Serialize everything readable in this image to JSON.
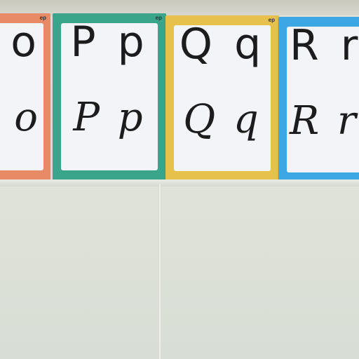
{
  "cards": [
    {
      "id": "o",
      "print": "o",
      "cursive": "o",
      "logo": "ep",
      "border_color": "#e88a66"
    },
    {
      "id": "p",
      "print": "P p",
      "cursive": "P p",
      "logo": "ep",
      "border_color": "#3aa58a"
    },
    {
      "id": "q",
      "print": "Q q",
      "cursive": "Q q",
      "logo": "ep",
      "border_color": "#e6c14c"
    },
    {
      "id": "r",
      "print": "R r",
      "cursive": "R r",
      "logo": "",
      "border_color": "#3da6e4"
    }
  ]
}
